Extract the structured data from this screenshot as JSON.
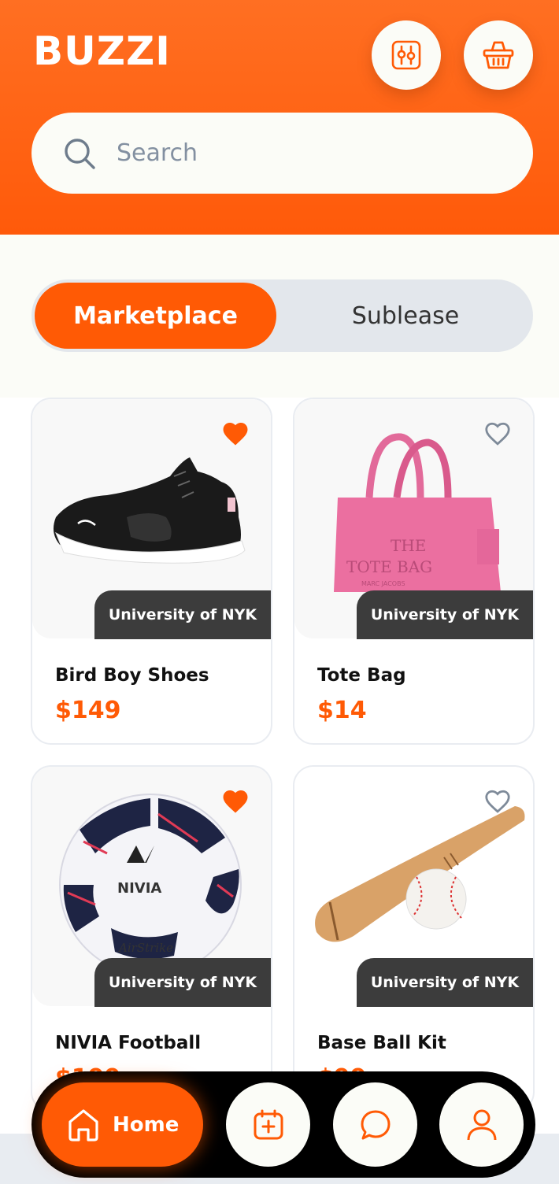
{
  "app": {
    "title": "BUZZI"
  },
  "search": {
    "placeholder": "Search"
  },
  "tabs": [
    {
      "label": "Marketplace",
      "active": true
    },
    {
      "label": "Sublease",
      "active": false
    }
  ],
  "products": [
    {
      "name": "Bird Boy Shoes",
      "price": "$149",
      "school": "University of NYK",
      "favorited": true,
      "image": "black-sneaker"
    },
    {
      "name": "Tote Bag",
      "price": "$14",
      "school": "University of NYK",
      "favorited": false,
      "image": "pink-tote-bag",
      "image_text": [
        "THE",
        "TOTE BAG",
        "MARC JACOBS"
      ]
    },
    {
      "name": "NIVIA Football",
      "price": "$199",
      "school": "University of NYK",
      "favorited": true,
      "image": "soccer-ball",
      "image_text": [
        "NIVIA",
        "AirStrike"
      ]
    },
    {
      "name": "Base Ball Kit",
      "price": "$99",
      "school": "University of NYK",
      "favorited": false,
      "image": "baseball-bat-and-ball"
    }
  ],
  "nav": {
    "home_label": "Home",
    "items": [
      "home-icon",
      "calendar-add-icon",
      "chat-icon",
      "profile-icon"
    ]
  },
  "colors": {
    "accent": "#FF5A05",
    "header": "#FF6A1A",
    "tag": "#3C3C3C",
    "background": "#FBFCF7"
  }
}
